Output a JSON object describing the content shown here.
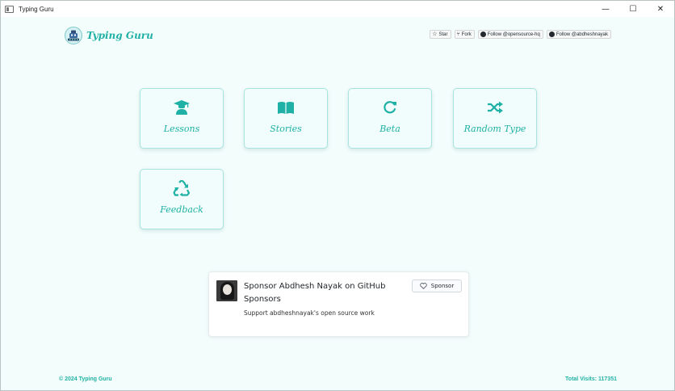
{
  "window": {
    "title": "Typing Guru",
    "controls": {
      "minimize": "—",
      "maximize": "☐",
      "close": "✕"
    }
  },
  "header": {
    "brand": "Typing Guru",
    "logo_icon": "keyboard-bot-icon",
    "github_buttons": [
      {
        "label": "Star",
        "icon": "star-icon"
      },
      {
        "label": "Fork",
        "icon": "fork-icon"
      },
      {
        "label": "Follow @opensource-hq",
        "icon": "github-icon"
      },
      {
        "label": "Follow @abdheshnayak",
        "icon": "github-icon"
      }
    ]
  },
  "cards": [
    {
      "label": "Lessons",
      "icon": "graduate-icon"
    },
    {
      "label": "Stories",
      "icon": "book-icon"
    },
    {
      "label": "Beta",
      "icon": "refresh-icon"
    },
    {
      "label": "Random Type",
      "icon": "shuffle-icon"
    },
    {
      "label": "Feedback",
      "icon": "recycle-icon"
    }
  ],
  "sponsor": {
    "title": "Sponsor Abdhesh Nayak on GitHub Sponsors",
    "description": "Support abdheshnayak's open source work",
    "button_label": "Sponsor"
  },
  "footer": {
    "copyright": "© 2024 Typing Guru",
    "visits": "Total Visits: 117351"
  },
  "colors": {
    "accent": "#1fb1a5",
    "background": "#f3fdfc",
    "card_border": "#a8e3df"
  }
}
